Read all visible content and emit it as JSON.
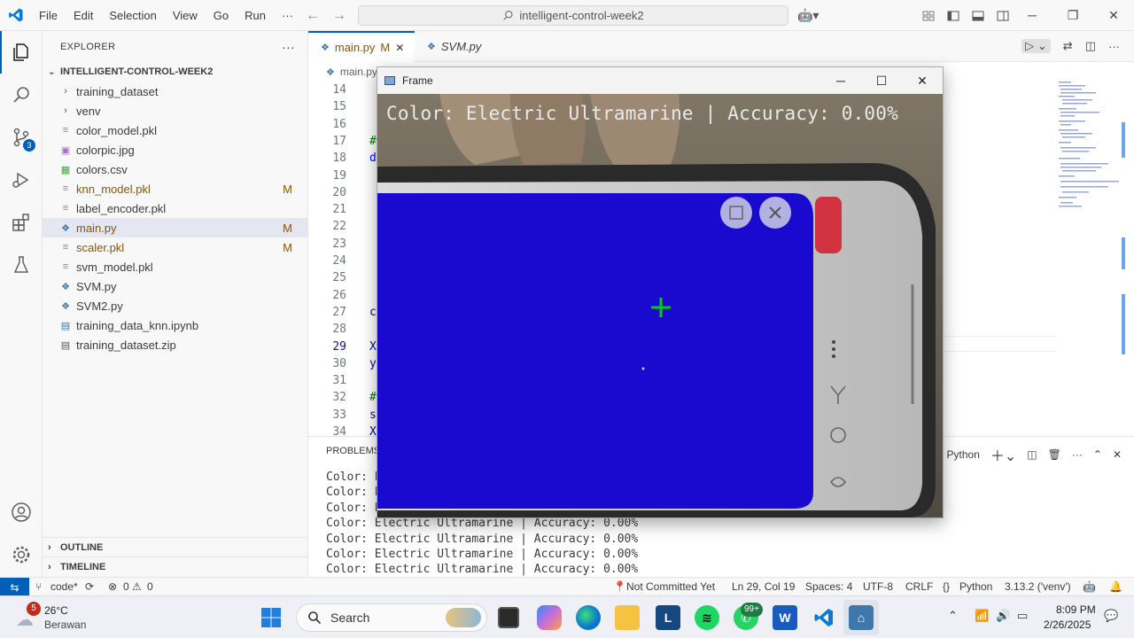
{
  "titlebar": {
    "menu": [
      "File",
      "Edit",
      "Selection",
      "View",
      "Go",
      "Run",
      "···"
    ],
    "search_text": "intelligent-control-week2"
  },
  "activity": {
    "scm_badge": "3"
  },
  "explorer": {
    "header": "EXPLORER",
    "more": "···",
    "folder": "INTELLIGENT-CONTROL-WEEK2",
    "items": [
      {
        "label": "training_dataset",
        "type": "folder",
        "mod": ""
      },
      {
        "label": "venv",
        "type": "folder",
        "mod": ""
      },
      {
        "label": "color_model.pkl",
        "type": "file",
        "mod": ""
      },
      {
        "label": "colorpic.jpg",
        "type": "image",
        "mod": ""
      },
      {
        "label": "colors.csv",
        "type": "csv",
        "mod": ""
      },
      {
        "label": "knn_model.pkl",
        "type": "file",
        "mod": "M"
      },
      {
        "label": "label_encoder.pkl",
        "type": "file",
        "mod": ""
      },
      {
        "label": "main.py",
        "type": "python",
        "mod": "M"
      },
      {
        "label": "scaler.pkl",
        "type": "file",
        "mod": "M"
      },
      {
        "label": "svm_model.pkl",
        "type": "file",
        "mod": ""
      },
      {
        "label": "SVM.py",
        "type": "python",
        "mod": ""
      },
      {
        "label": "SVM2.py",
        "type": "python",
        "mod": ""
      },
      {
        "label": "training_data_knn.ipynb",
        "type": "notebook",
        "mod": ""
      },
      {
        "label": "training_dataset.zip",
        "type": "zip",
        "mod": ""
      }
    ],
    "outline": "OUTLINE",
    "timeline": "TIMELINE"
  },
  "tabs": [
    {
      "label": "main.py",
      "mod": "M"
    },
    {
      "label": "SVM.py",
      "mod": ""
    }
  ],
  "breadcrumb": "main.py",
  "editor": {
    "lines": [
      {
        "n": "14",
        "code": ""
      },
      {
        "n": "15",
        "code": ""
      },
      {
        "n": "16",
        "code": ""
      },
      {
        "n": "17",
        "code": "#"
      },
      {
        "n": "18",
        "code": "d"
      },
      {
        "n": "19",
        "code": ""
      },
      {
        "n": "20",
        "code": ""
      },
      {
        "n": "21",
        "code": ""
      },
      {
        "n": "22",
        "code": ""
      },
      {
        "n": "23",
        "code": ""
      },
      {
        "n": "24",
        "code": ""
      },
      {
        "n": "25",
        "code": ""
      },
      {
        "n": "26",
        "code": ""
      },
      {
        "n": "27",
        "code": "c"
      },
      {
        "n": "28",
        "code": ""
      },
      {
        "n": "29",
        "code": "X"
      },
      {
        "n": "30",
        "code": "y"
      },
      {
        "n": "31",
        "code": ""
      },
      {
        "n": "32",
        "code": "#"
      },
      {
        "n": "33",
        "code": "s"
      },
      {
        "n": "34",
        "code": "X"
      }
    ]
  },
  "panel": {
    "tab": "PROBLEMS",
    "terminal_name": "Python",
    "lines": [
      "Color: E",
      "Color: E",
      "Color: E",
      "Color: Electric Ultramarine | Accuracy: 0.00%",
      "Color: Electric Ultramarine | Accuracy: 0.00%",
      "Color: Electric Ultramarine | Accuracy: 0.00%",
      "Color: Electric Ultramarine | Accuracy: 0.00%"
    ]
  },
  "frame": {
    "title": "Frame",
    "overlay": "Color: Electric Ultramarine | Accuracy: 0.00%",
    "phone_screen_color": "#1a0ad0",
    "crosshair_color": "#00d000"
  },
  "statusbar": {
    "branch": "code*",
    "errors": "0",
    "warnings": "0",
    "commit": "Not Committed Yet",
    "position": "Ln 29, Col 19",
    "spaces": "Spaces: 4",
    "encoding": "UTF-8",
    "eol": "CRLF",
    "language": "Python",
    "interpreter": "3.13.2 ('venv')"
  },
  "taskbar": {
    "weather_temp": "26°C",
    "weather_desc": "Berawan",
    "weather_badge": "5",
    "search": "Search",
    "whatsapp_badge": "99+",
    "time": "8:09 PM",
    "date": "2/26/2025"
  }
}
